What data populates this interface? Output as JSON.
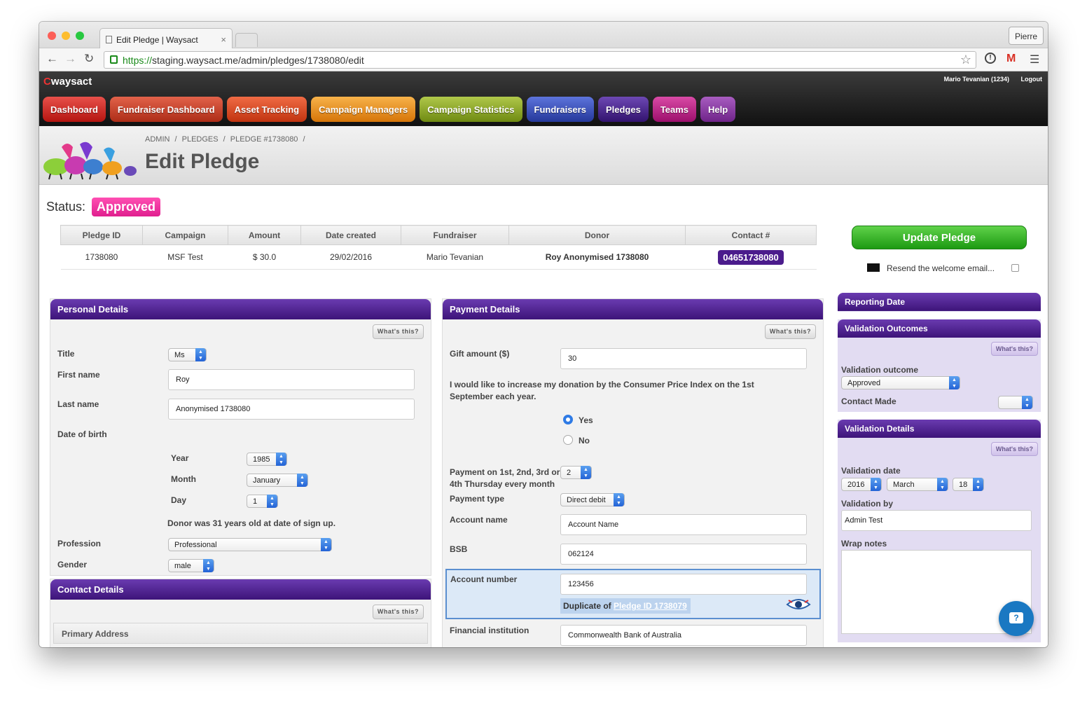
{
  "browser": {
    "tab_title": "Edit Pledge | Waysact",
    "tab_close": "×",
    "profile": "Pierre",
    "url_scheme": "https://",
    "url_rest": "staging.waysact.me/admin/pledges/1738080/edit",
    "icons": [
      "back-icon",
      "forward-icon",
      "reload-icon",
      "star-icon",
      "info-icon",
      "gmail-icon",
      "menu-icon"
    ]
  },
  "app": {
    "logo_prefix": "C",
    "logo": "waysact",
    "user": "Mario Tevanian (1234)",
    "logout": "Logout",
    "nav": [
      {
        "label": "Dashboard",
        "color": "#c8241e"
      },
      {
        "label": "Fundraiser Dashboard",
        "color": "#c8402a"
      },
      {
        "label": "Asset Tracking",
        "color": "#d84a23"
      },
      {
        "label": "Campaign Managers",
        "color": "#e39020"
      },
      {
        "label": "Campaign Statistics",
        "color": "#8aa62a"
      },
      {
        "label": "Fundraisers",
        "color": "#3a4fb8"
      },
      {
        "label": "Pledges",
        "color": "#4a2a8a"
      },
      {
        "label": "Teams",
        "color": "#b81f83"
      },
      {
        "label": "Help",
        "color": "#8a3aa0"
      }
    ]
  },
  "header": {
    "breadcrumb": [
      "ADMIN",
      "/",
      "PLEDGES",
      "/",
      "PLEDGE #1738080",
      "/"
    ],
    "title": "Edit Pledge"
  },
  "status": {
    "label": "Status:",
    "value": "Approved"
  },
  "summary": {
    "columns": [
      "Pledge ID",
      "Campaign",
      "Amount",
      "Date created",
      "Fundraiser",
      "Donor",
      "Contact #"
    ],
    "row": [
      "1738080",
      "MSF Test",
      "$ 30.0",
      "29/02/2016",
      "Mario Tevanian",
      "Roy Anonymised 1738080",
      "04651738080"
    ]
  },
  "actions": {
    "update": "Update Pledge",
    "resend": "Resend the welcome email..."
  },
  "whats_this": "What's this?",
  "personal": {
    "heading": "Personal Details",
    "title_label": "Title",
    "title_value": "Ms",
    "first_label": "First name",
    "first_value": "Roy",
    "last_label": "Last name",
    "last_value": "Anonymised 1738080",
    "dob_label": "Date of birth",
    "year_label": "Year",
    "year_value": "1985",
    "month_label": "Month",
    "month_value": "January",
    "day_label": "Day",
    "day_value": "1",
    "age_note": "Donor was 31 years old at date of sign up.",
    "profession_label": "Profession",
    "profession_value": "Professional",
    "gender_label": "Gender",
    "gender_value": "male"
  },
  "contact": {
    "heading": "Contact Details",
    "primary": "Primary Address"
  },
  "payment": {
    "heading": "Payment Details",
    "gift_label": "Gift amount ($)",
    "gift_value": "30",
    "cpi_text": "I would like to increase my donation by the Consumer Price Index on the 1st September each year.",
    "yes": "Yes",
    "no": "No",
    "thursday_label": "Payment on 1st, 2nd, 3rd or 4th Thursday every month",
    "thursday_value": "2",
    "type_label": "Payment type",
    "type_value": "Direct debit",
    "acct_name_label": "Account name",
    "acct_name_value": "Account Name",
    "bsb_label": "BSB",
    "bsb_value": "062124",
    "acct_num_label": "Account number",
    "acct_num_value": "123456",
    "dup_prefix": "Duplicate of",
    "dup_link": "Pledge ID 1738079",
    "fin_label": "Financial institution",
    "fin_value": "Commonwealth Bank of Australia"
  },
  "side": {
    "reporting": "Reporting Date",
    "outcomes": "Validation Outcomes",
    "outcome_label": "Validation outcome",
    "outcome_value": "Approved",
    "contact_made_label": "Contact Made",
    "contact_made_value": "",
    "details": "Validation Details",
    "date_label": "Validation date",
    "date_year": "2016",
    "date_month": "March",
    "date_day": "18",
    "by_label": "Validation by",
    "by_value": "Admin Test",
    "wrap_label": "Wrap notes",
    "wrap_value": ""
  },
  "help_glyph": "?"
}
